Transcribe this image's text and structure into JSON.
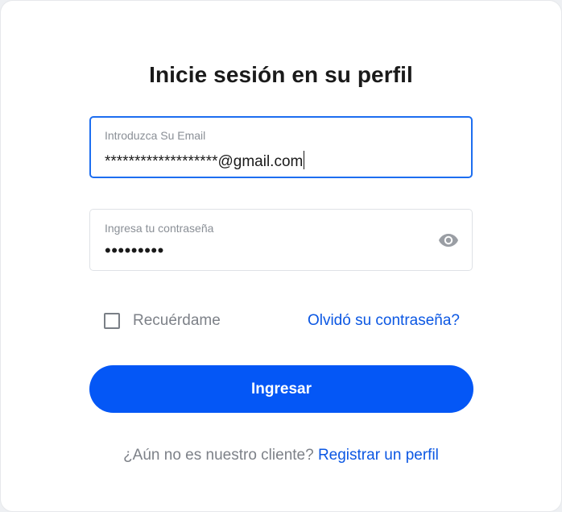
{
  "login": {
    "title": "Inicie sesión en su perfil",
    "email": {
      "label": "Introduzca Su Email",
      "value": "*******************@gmail.com"
    },
    "password": {
      "label": "Ingresa tu contraseña",
      "value": "•••••••••",
      "toggle_icon": "eye-icon"
    },
    "remember_label": "Recuérdame",
    "remember_checked": false,
    "forgot_link": "Olvidó su contraseña?",
    "submit_label": "Ingresar",
    "register_prompt": "¿Aún no es nuestro cliente?",
    "register_link": "Registrar un perfil"
  },
  "colors": {
    "accent": "#0457f6",
    "link": "#0b57e3",
    "focus_border": "#1d6ef0"
  }
}
